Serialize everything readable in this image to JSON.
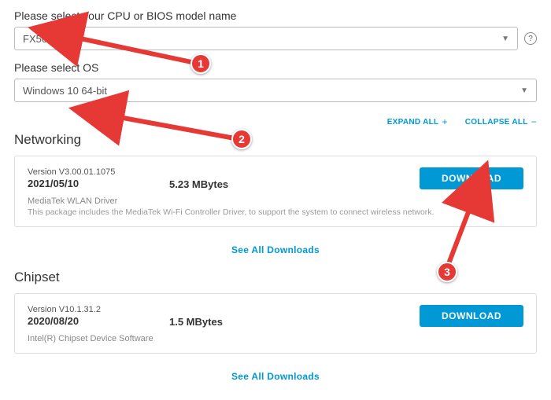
{
  "cpu_section": {
    "label": "Please select your CPU or BIOS model name",
    "value": "FX506LH"
  },
  "os_section": {
    "label": "Please select OS",
    "value": "Windows 10 64-bit"
  },
  "actions": {
    "expand": "EXPAND ALL",
    "collapse": "COLLAPSE ALL"
  },
  "networking": {
    "title": "Networking",
    "version_label": "Version V3.00.01.1075",
    "date": "2021/05/10",
    "size": "5.23 MBytes",
    "download": "DOWNLOAD",
    "driver_name": "MediaTek WLAN Driver",
    "driver_desc": "This package includes the MediaTek Wi-Fi Controller Driver, to support the system to connect wireless network.",
    "see_all": "See All Downloads"
  },
  "chipset": {
    "title": "Chipset",
    "version_label": "Version V10.1.31.2",
    "date": "2020/08/20",
    "size": "1.5 MBytes",
    "download": "DOWNLOAD",
    "driver_name": "Intel(R) Chipset Device Software",
    "see_all": "See All Downloads"
  },
  "annotations": {
    "b1": "1",
    "b2": "2",
    "b3": "3"
  }
}
